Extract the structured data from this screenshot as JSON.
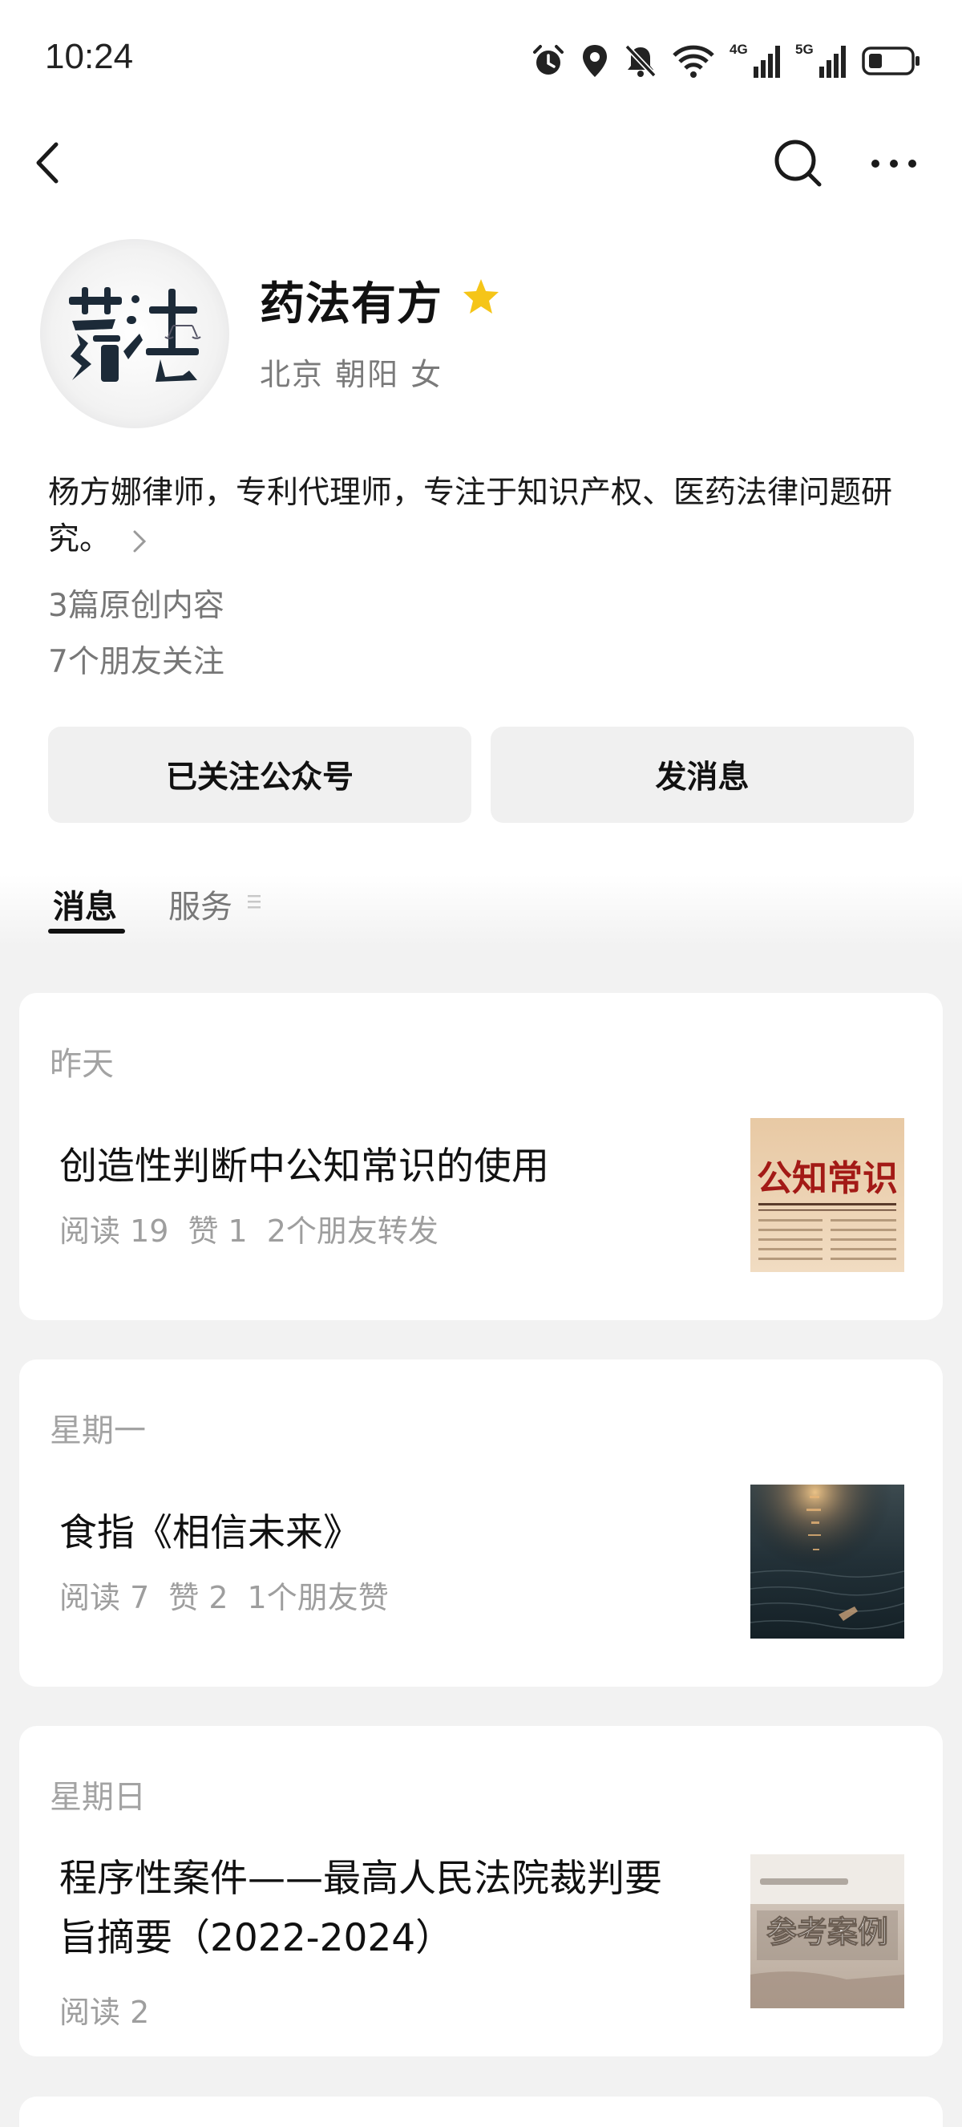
{
  "status_bar": {
    "time": "10:24",
    "icons": [
      "alarm-icon",
      "location-icon",
      "mute-icon",
      "wifi-icon",
      "signal-4g-icon",
      "signal-5g-icon",
      "battery-icon"
    ],
    "network_labels": [
      "4G",
      "5G"
    ]
  },
  "nav": {
    "icons": [
      "back-icon",
      "search-icon",
      "more-icon"
    ]
  },
  "profile": {
    "name": "药法有方",
    "location": "北京 朝阳 女",
    "bio": "杨方娜律师，专利代理师，专注于知识产权、医药法律问题研究。",
    "original_count": "3篇原创内容",
    "friends_following": "7个朋友关注",
    "star_color": "#F5C518"
  },
  "actions": {
    "follow_label": "已关注公众号",
    "message_label": "发消息"
  },
  "tabs": [
    {
      "label": "消息",
      "active": true
    },
    {
      "label": "服务",
      "active": false
    }
  ],
  "articles": [
    {
      "date": "昨天",
      "title": "创造性判断中公知常识的使用",
      "meta": [
        "阅读 19",
        "赞 1",
        "2个朋友转发"
      ],
      "thumb_text": "公知常识"
    },
    {
      "date": "星期一",
      "title": "食指《相信未来》",
      "meta": [
        "阅读 7",
        "赞 2",
        "1个朋友赞"
      ]
    },
    {
      "date": "星期日",
      "title_lines": [
        "程序性案件——最高人民法院裁判要",
        "旨摘要（2022-2024）"
      ],
      "meta": [
        "阅读 2"
      ],
      "thumb_text": "参考案例"
    }
  ]
}
